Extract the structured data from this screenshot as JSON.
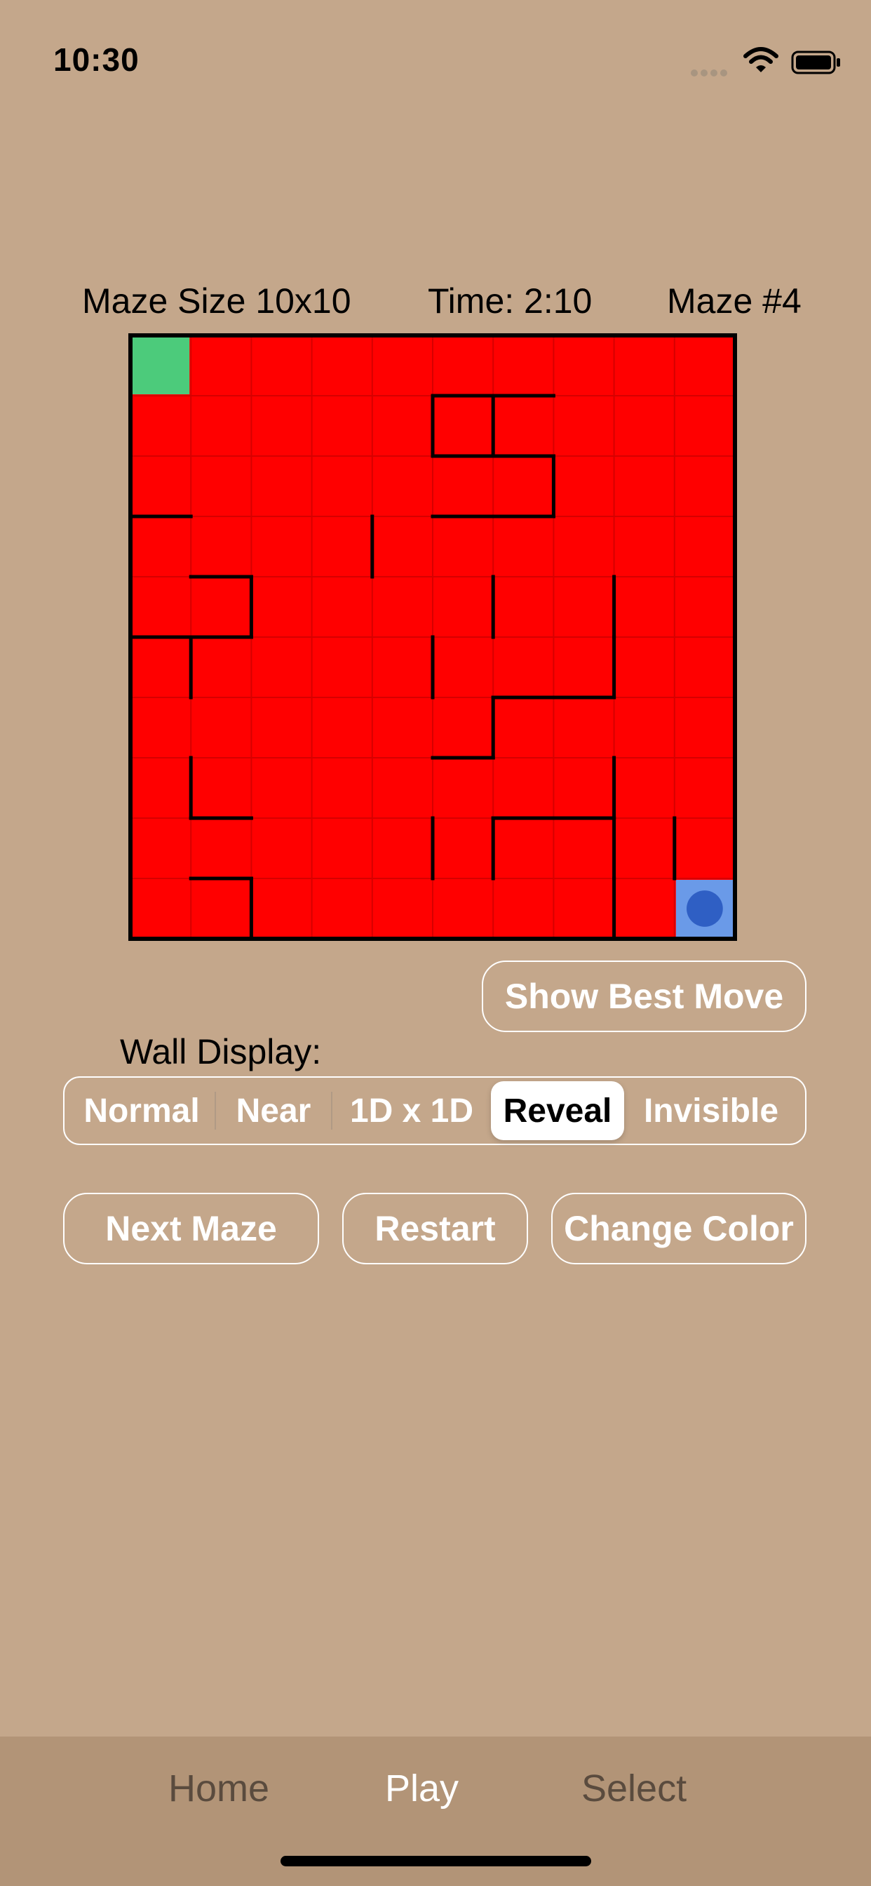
{
  "status_bar": {
    "time": "10:30",
    "wifi_icon": "wifi-icon",
    "battery_icon": "battery-icon"
  },
  "header": {
    "maze_size": "Maze Size 10x10",
    "time": "Time: 2:10",
    "maze_number": "Maze #4"
  },
  "maze": {
    "rows": 10,
    "cols": 10,
    "fill_color": "#ff0000",
    "start_color": "#4ccb7b",
    "goal_color": "#6a9ae8",
    "player_color": "#2f5fc4",
    "start_cell": [
      0,
      0
    ],
    "goal_cell": [
      9,
      9
    ],
    "player_cell": [
      9,
      9
    ],
    "walls_h": [
      [
        1,
        5
      ],
      [
        1,
        6
      ],
      [
        3,
        0
      ],
      [
        3,
        5
      ],
      [
        3,
        6
      ],
      [
        4,
        1
      ],
      [
        5,
        0
      ],
      [
        5,
        1
      ],
      [
        6,
        6
      ],
      [
        8,
        1
      ],
      [
        8,
        6
      ],
      [
        8,
        7
      ],
      [
        9,
        1
      ],
      [
        7,
        5
      ],
      [
        2,
        5
      ],
      [
        2,
        6
      ],
      [
        6,
        7
      ]
    ],
    "walls_v": [
      [
        1,
        5
      ],
      [
        1,
        6
      ],
      [
        2,
        7
      ],
      [
        3,
        4
      ],
      [
        4,
        2
      ],
      [
        4,
        6
      ],
      [
        4,
        8
      ],
      [
        5,
        1
      ],
      [
        5,
        5
      ],
      [
        5,
        8
      ],
      [
        6,
        6
      ],
      [
        7,
        1
      ],
      [
        7,
        8
      ],
      [
        8,
        5
      ],
      [
        8,
        6
      ],
      [
        8,
        8
      ],
      [
        8,
        9
      ],
      [
        9,
        2
      ],
      [
        9,
        8
      ]
    ]
  },
  "actions": {
    "show_best_move": "Show Best Move",
    "next_maze": "Next Maze",
    "restart": "Restart",
    "change_color": "Change Color"
  },
  "wall_display": {
    "label": "Wall Display:",
    "options": [
      "Normal",
      "Near",
      "1D x 1D",
      "Reveal",
      "Invisible"
    ],
    "selected": "Reveal"
  },
  "tabs": {
    "home": "Home",
    "play": "Play",
    "select": "Select",
    "active": "Play"
  }
}
